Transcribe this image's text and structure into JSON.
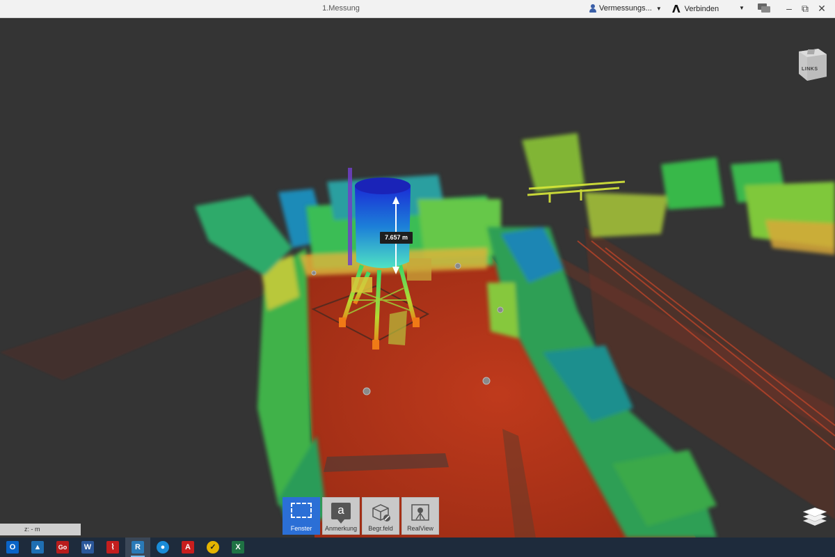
{
  "window": {
    "title": "1.Messung",
    "user_menu": "Vermessungs...",
    "connect_label": "Verbinden",
    "minimize": "–",
    "restore": "⧉",
    "close": "✕"
  },
  "viewport": {
    "measurement": "7.657 m",
    "viewcube_label": "LINKS",
    "scale_text": "z: - m"
  },
  "toolbar": [
    {
      "label": "Fenster",
      "icon": "selection-window-icon",
      "active": true
    },
    {
      "label": "Anmerkung",
      "icon": "annotation-icon",
      "glyph": "a",
      "active": false
    },
    {
      "label": "Begr.feld",
      "icon": "limit-box-icon",
      "active": false
    },
    {
      "label": "RealView",
      "icon": "realview-icon",
      "active": false
    }
  ],
  "taskbar": [
    {
      "name": "outlook",
      "glyph": "O",
      "color": "#0a64c8"
    },
    {
      "name": "photos",
      "glyph": "▲",
      "color": "#1f6fb3"
    },
    {
      "name": "gomeasure",
      "glyph": "Go",
      "color": "#b81c1c"
    },
    {
      "name": "word",
      "glyph": "W",
      "color": "#2b579a"
    },
    {
      "name": "acrobat",
      "glyph": "⌇",
      "color": "#c41e1e"
    },
    {
      "name": "recap",
      "glyph": "R",
      "color": "#2a7ab8",
      "active": true
    },
    {
      "name": "webex",
      "glyph": "●",
      "color": "#1a8cd8"
    },
    {
      "name": "autocad",
      "glyph": "A",
      "color": "#c81e1e"
    },
    {
      "name": "norton",
      "glyph": "✓",
      "color": "#e5b400"
    },
    {
      "name": "excel",
      "glyph": "X",
      "color": "#1f7244"
    }
  ],
  "colors": {
    "viewport_bg": "#343434",
    "ground_red": "#b8341a",
    "active_tool": "#2b6fd6",
    "taskbar": "#1e2b3c"
  }
}
